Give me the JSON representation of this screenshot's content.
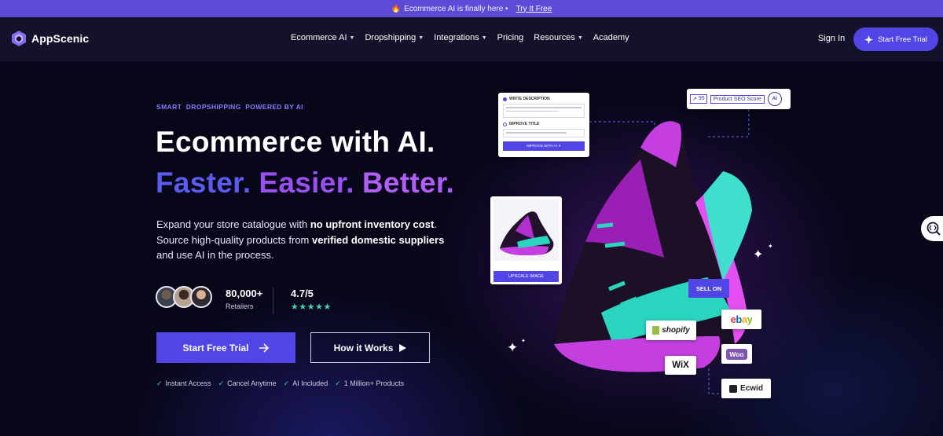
{
  "promo": {
    "text": "Ecommerce AI is finally here •",
    "link": "Try It Free"
  },
  "nav": {
    "brand": "AppScenic",
    "menu": [
      {
        "label": "Ecommerce AI",
        "dropdown": true
      },
      {
        "label": "Dropshipping",
        "dropdown": true
      },
      {
        "label": "Integrations",
        "dropdown": true
      },
      {
        "label": "Pricing",
        "dropdown": false
      },
      {
        "label": "Resources",
        "dropdown": true
      },
      {
        "label": "Academy",
        "dropdown": false
      }
    ],
    "sign_in": "Sign In",
    "cta": "Start Free Trial"
  },
  "hero": {
    "eyebrow": "SMART  DROPSHIPPING  POWERED BY AI",
    "headline": "Ecommerce with AI.",
    "tagline": [
      "Faster.",
      "Easier.",
      "Better."
    ],
    "desc_1": "Expand your store catalogue with ",
    "desc_2": "no upfront inventory cost",
    "desc_3": ". Source high-quality products from ",
    "desc_4": "verified domestic suppliers",
    "desc_5": " and use AI in the process.",
    "stat_retailers_value": "80,000+",
    "stat_retailers_label": "Retailers",
    "stat_rating_value": "4.7/5",
    "stars": "★★★★★",
    "primary_cta": "Start Free Trial",
    "secondary_cta": "How it Works",
    "checks": [
      "Instant Access",
      "Cancel Anytime",
      "AI Included",
      "1 Million+ Products"
    ]
  },
  "visual": {
    "write_card": {
      "option_1": "WRITE DESCRIPTION",
      "option_2": "IMPROVE TITLE",
      "button": "IMPROVE WITH AI ✦"
    },
    "seo_card": {
      "score": "95",
      "label": "Product SEO Score",
      "ai": "AI"
    },
    "upscale_button": "UPSCALE IMAGE",
    "sell_on": "SELL ON",
    "platforms": {
      "shopify": "shopify",
      "ebay": "ebay",
      "woo": "Woo",
      "wix": "WiX",
      "ecwid": "Ecwid"
    }
  },
  "colors": {
    "accent": "#5146e5",
    "teal": "#3fd4b5",
    "magenta": "#c43ee0",
    "background": "#08071a"
  },
  "icons": [
    "fire-icon",
    "logo-icon",
    "chevron-down-icon",
    "spark-icon",
    "arrow-right-icon",
    "play-icon",
    "check-icon",
    "sparkle-icon",
    "ai-search-icon"
  ]
}
